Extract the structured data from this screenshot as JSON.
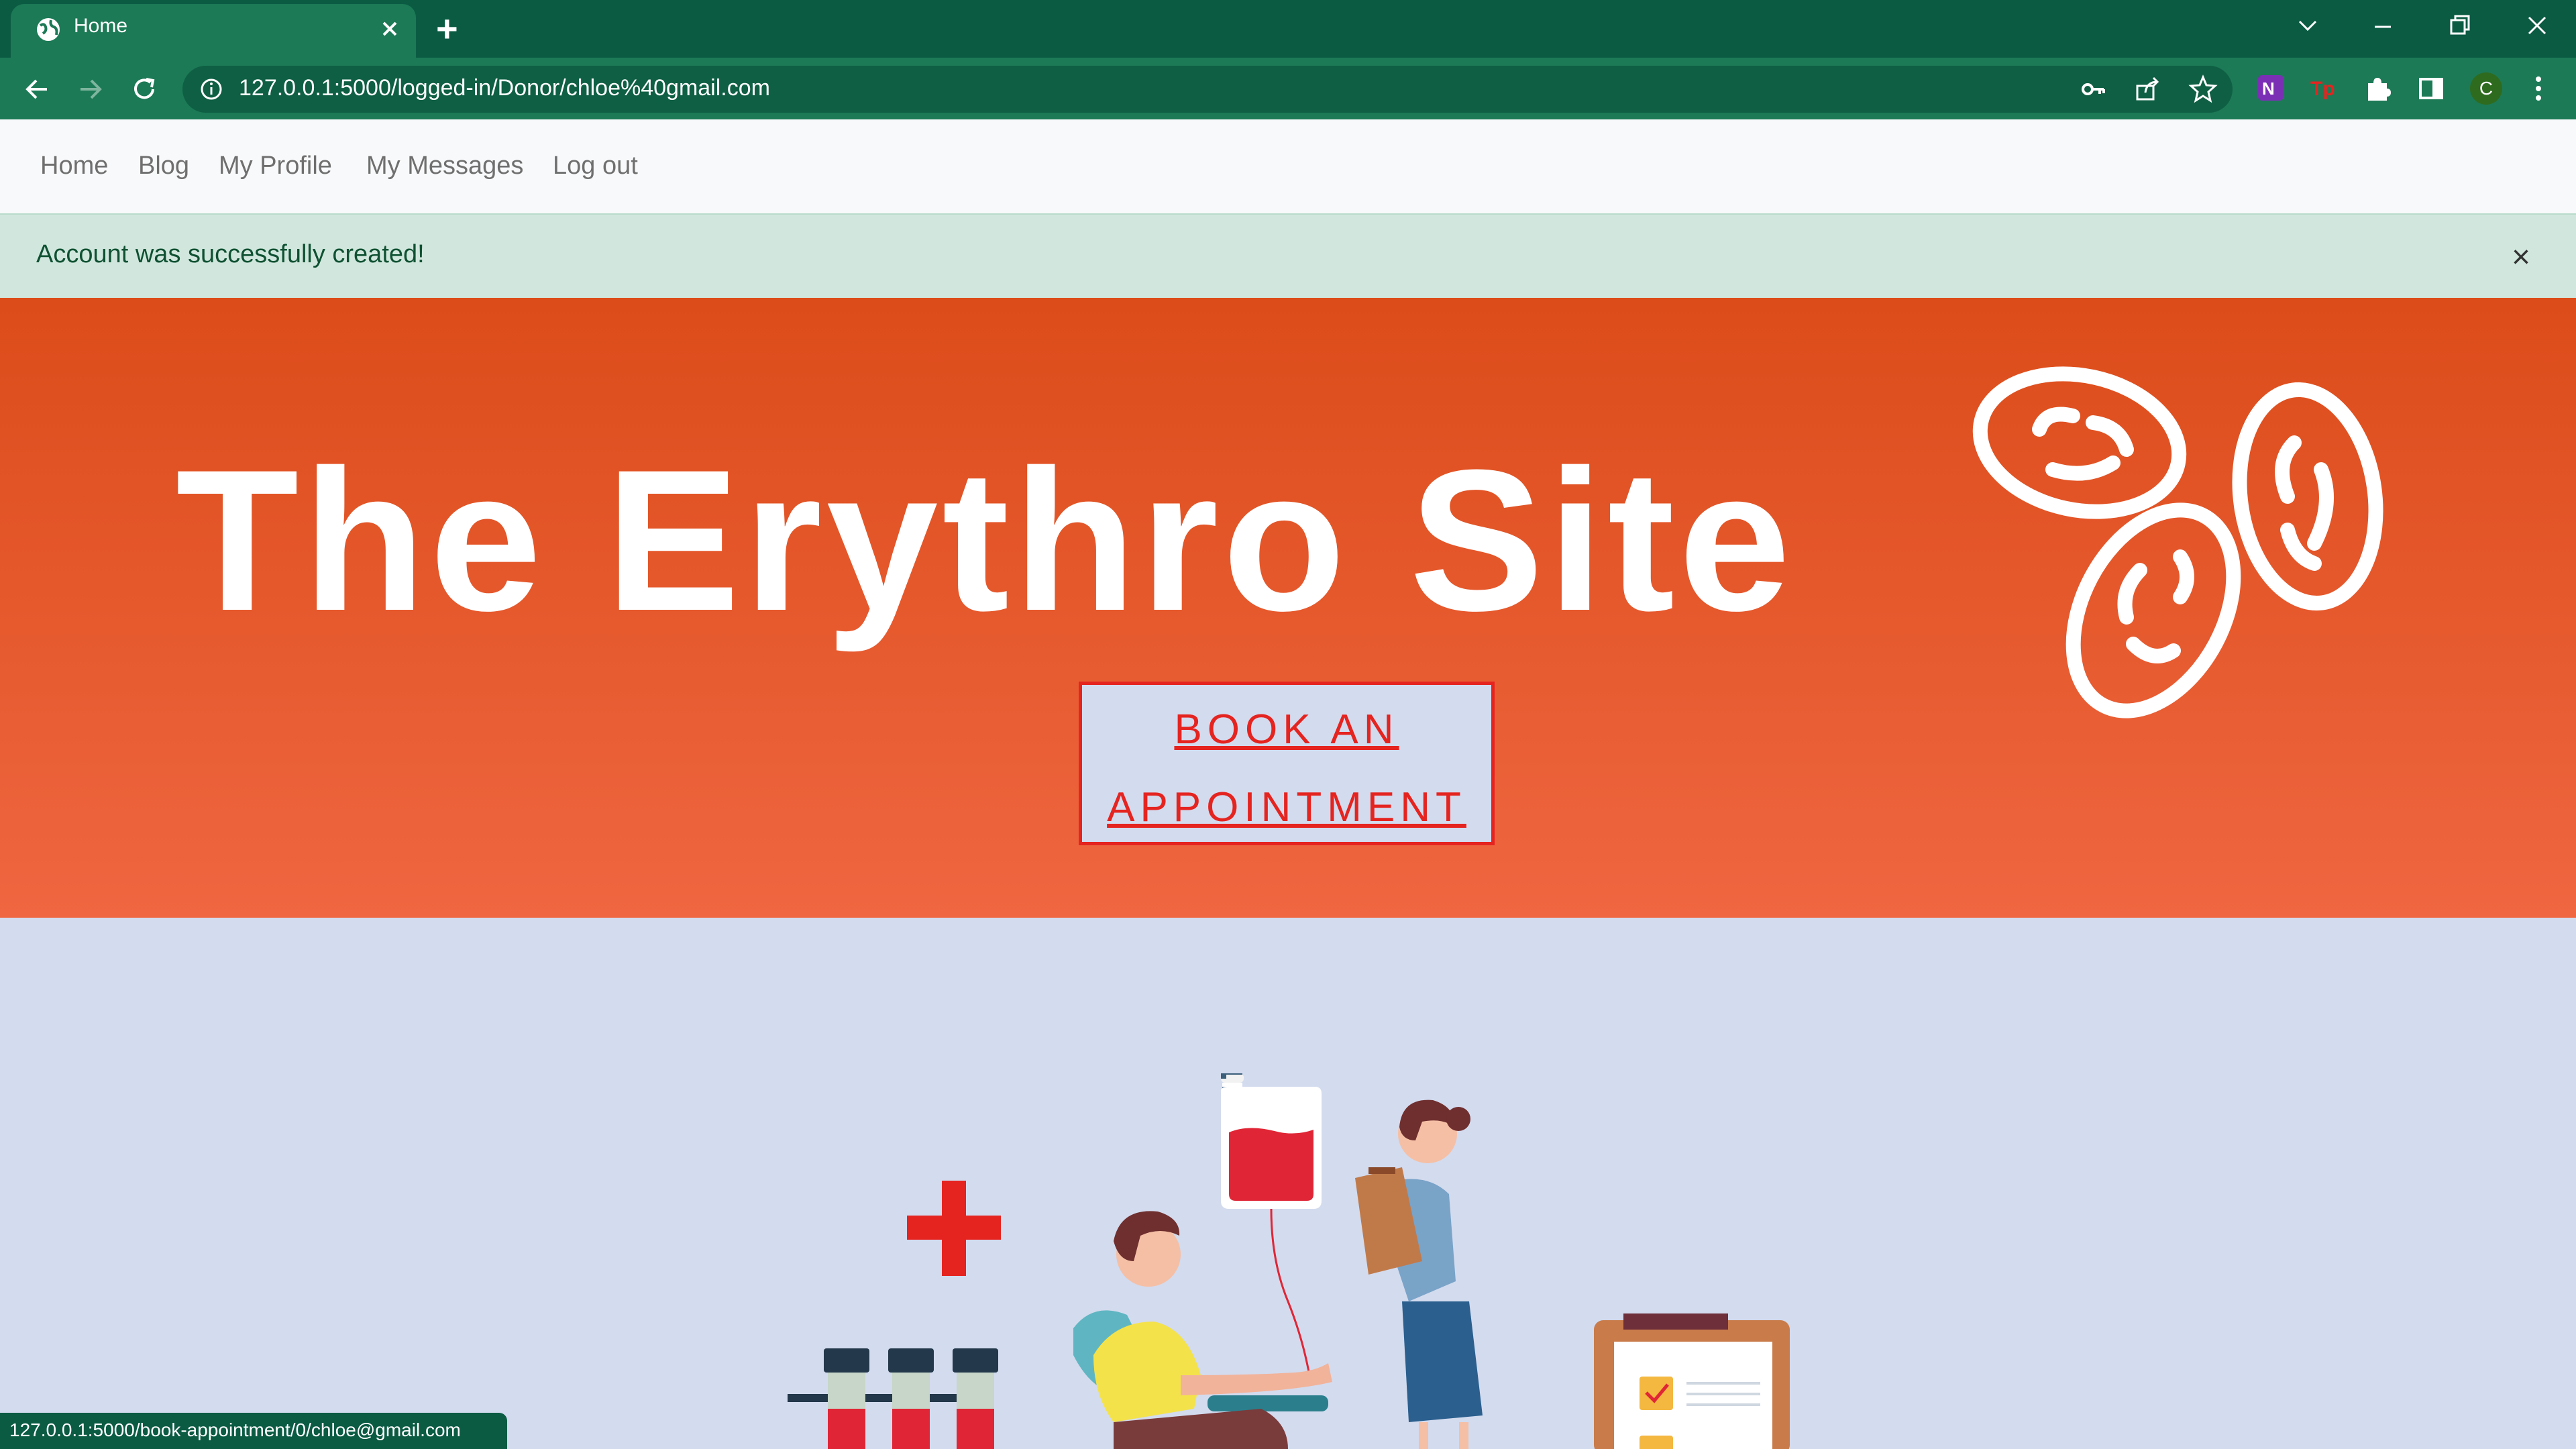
{
  "browser": {
    "tab_title": "Home",
    "new_tab": "+",
    "url": "127.0.0.1:5000/logged-in/Donor/chloe%40gmail.com",
    "profile_initial": "C",
    "status_url": "127.0.0.1:5000/book-appointment/0/chloe@gmail.com"
  },
  "nav": {
    "items": [
      "Home",
      "Blog",
      "My Profile",
      "My Messages",
      "Log out"
    ]
  },
  "alert": {
    "message": "Account was successfully created!",
    "close": "×"
  },
  "hero": {
    "title": "The Erythro Site",
    "button_line1": "BOOK AN",
    "button_line2": "APPOINTMENT"
  },
  "colors": {
    "chrome": "#0b5b43",
    "hero_top": "#dc4c1a",
    "hero_bottom": "#ef6640",
    "accent_red": "#e52420",
    "page_bg": "#d3dbee",
    "alert_bg": "#d1e7dd"
  },
  "icons": [
    "globe-icon",
    "close-icon",
    "plus-icon",
    "chevron-down-icon",
    "minimize-icon",
    "restore-icon",
    "back-icon",
    "forward-icon",
    "reload-icon",
    "info-icon",
    "key-icon",
    "share-icon",
    "star-icon",
    "onenote-icon",
    "tp-icon",
    "puzzle-icon",
    "sidepanel-icon",
    "menu-icon",
    "blood-cell-icon",
    "medical-cross-icon"
  ]
}
